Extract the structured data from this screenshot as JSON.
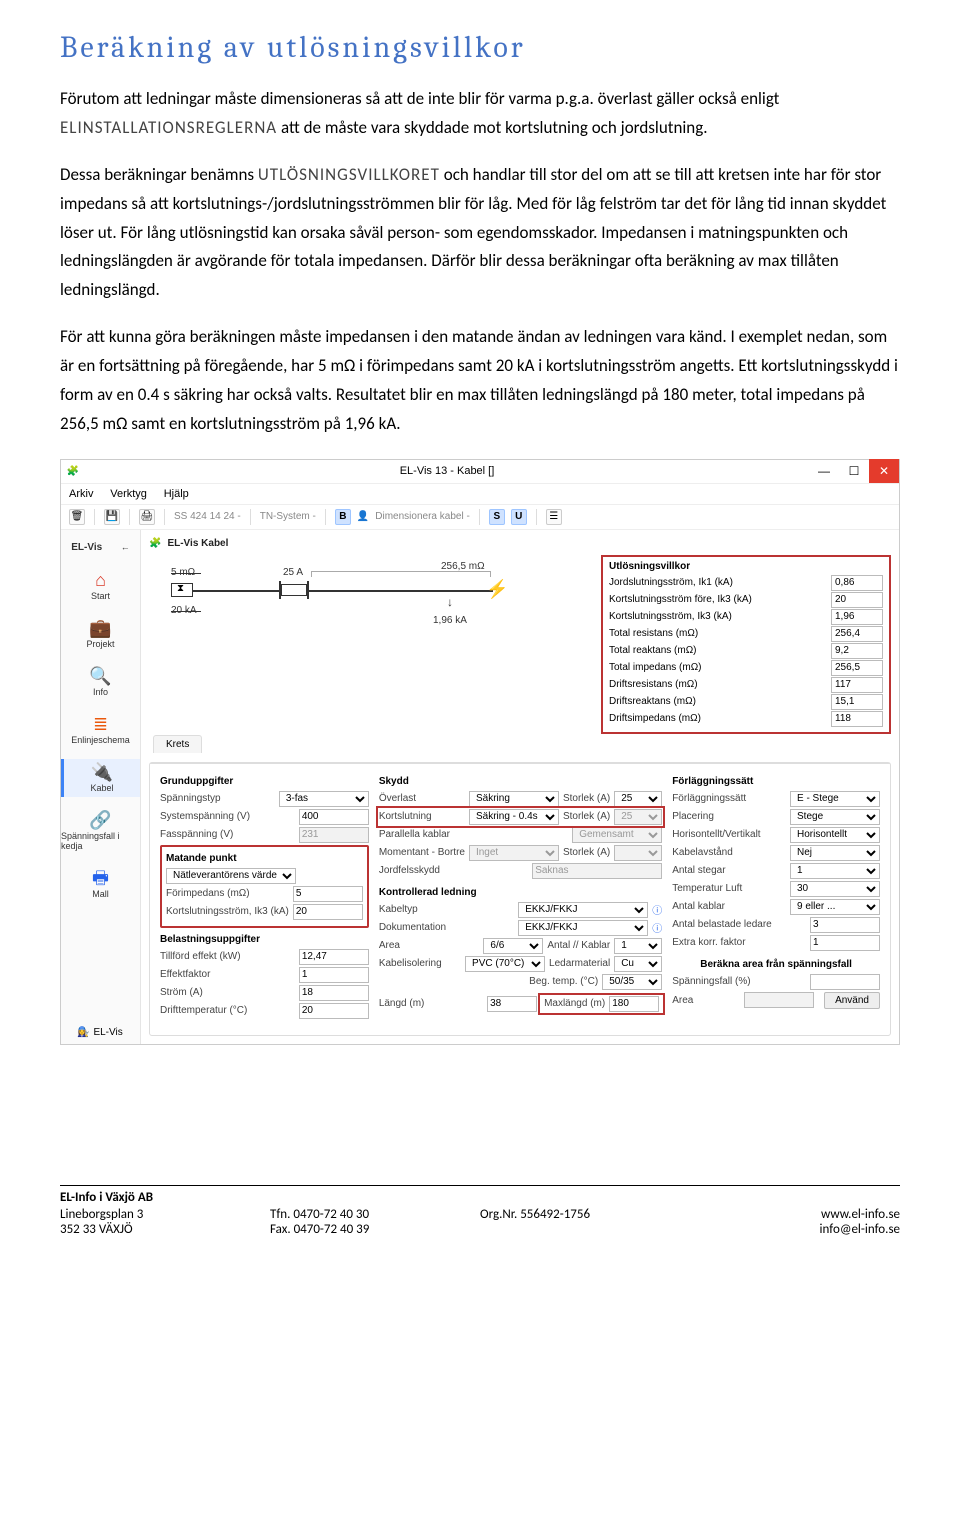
{
  "doc": {
    "heading": "Beräkning av utlösningsvillkor",
    "p1a": "Förutom att ledningar måste dimensioneras så att de inte blir för varma p.g.a. överlast gäller också enligt ",
    "p1r": "ELINSTALLATIONSREGLERNA",
    "p1b": " att de måste vara skyddade mot kortslutning och jordslutning.",
    "p2a": "Dessa beräkningar benämns ",
    "p2r": "UTLÖSNINGSVILLKORET",
    "p2b": " och handlar till stor del om att se till att kretsen inte har för stor impedans så att kortslutnings-/jordslutningsströmmen blir för låg. Med för låg felström tar det för lång tid innan skyddet löser ut. För lång utlösningstid kan orsaka såväl person- som egendomsskador. Impedansen i matningspunkten och ledningslängden är avgörande för totala impedansen. Därför blir dessa beräkningar ofta beräkning av max tillåten ledningslängd.",
    "p3": "För att kunna göra beräkningen måste impedansen i den matande ändan av ledningen vara känd. I exemplet nedan, som är en fortsättning på föregående, har 5 mΩ i förimpedans samt 20 kA i kortslutningsström angetts. Ett kortslutningsskydd i form av en 0.4 s säkring har också valts. Resultatet blir en max tillåten ledningslängd på 180 meter, total impedans på 256,5 mΩ samt en kortslutningsström på 1,96 kA."
  },
  "win": {
    "title": "EL-Vis 13 - Kabel []",
    "menu": {
      "arkiv": "Arkiv",
      "verktyg": "Verktyg",
      "hjalp": "Hjälp"
    },
    "toolbar": {
      "ss": "SS 424 14 24 -",
      "tns": "TN-System -",
      "dim": "Dimensionera kabel -",
      "B": "B",
      "S": "S",
      "U": "U"
    },
    "sidebar_brand": "EL-Vis",
    "subhead": "EL-Vis Kabel",
    "side": {
      "start": "Start",
      "projekt": "Projekt",
      "info": "Info",
      "enlinje": "Enlinjeschema",
      "kabel": "Kabel",
      "spfall": "Spänningsfall i kedja",
      "mall": "Mall"
    }
  },
  "diagram": {
    "imp": "5 mΩ",
    "ik": "20 kA",
    "amp": "25 A",
    "zline": "256,5 mΩ",
    "ikload": "1,96 kA"
  },
  "utlos": {
    "title": "Utlösningsvillkor",
    "rows": {
      "ik1": "Jordslutningsström, Ik1 (kA)",
      "ik1v": "0,86",
      "ik3f": "Kortslutningsström före, Ik3 (kA)",
      "ik3fv": "20",
      "ik3": "Kortslutningsström, Ik3 (kA)",
      "ik3v": "1,96",
      "rtot": "Total resistans (mΩ)",
      "rtotv": "256,4",
      "xtot": "Total reaktans (mΩ)",
      "xtotv": "9,2",
      "ztot": "Total impedans (mΩ)",
      "ztotv": "256,5",
      "rdrift": "Driftsresistans (mΩ)",
      "rdriftv": "117",
      "xdrift": "Driftsreaktans (mΩ)",
      "xdriftv": "15,1",
      "zdrift": "Driftsimpedans (mΩ)",
      "zdriftv": "118"
    }
  },
  "panel": {
    "tab": "Krets",
    "grund": {
      "hdr": "Grunduppgifter",
      "sptyp": "Spänningstyp",
      "sptypv": "3-fas",
      "syssp": "Systemspänning (V)",
      "sysspv": "400",
      "fassp": "Fasspänning (V)",
      "fasspv": "231"
    },
    "mat": {
      "hdr": "Matande punkt",
      "src": "Nätleverantörens värde",
      "forimp": "Förimpedans (mΩ)",
      "forimpv": "5",
      "ik3": "Kortslutningsström, Ik3 (kA)",
      "ik3v": "20"
    },
    "bel": {
      "hdr": "Belastningsuppgifter",
      "eff": "Tillförd effekt (kW)",
      "effv": "12,47",
      "pf": "Effektfaktor",
      "pfv": "1",
      "strom": "Ström (A)",
      "stromv": "18",
      "dtemp": "Drifttemperatur (°C)",
      "dtempv": "20"
    },
    "skydd": {
      "hdr": "Skydd",
      "over": "Överlast",
      "overv": "Säkring",
      "size": "Storlek (A)",
      "sizev": "25",
      "kort": "Kortslutning",
      "kortv": "Säkring - 0.4s",
      "kortsize": "25",
      "par": "Parallella kablar",
      "parv": "Gemensamt",
      "mom": "Momentant - Bortre",
      "momv": "Inget",
      "jord": "Jordfelsskydd",
      "jordv": "Saknas"
    },
    "led": {
      "hdr": "Kontrollerad ledning",
      "ktyp": "Kabeltyp",
      "ktypv": "EKKJ/FKKJ",
      "dok": "Dokumentation",
      "dokv": "EKKJ/FKKJ",
      "area": "Area",
      "areav": "6/6",
      "antk": "Antal // Kablar",
      "antkv": "1",
      "kiso": "Kabelisolering",
      "kisov": "PVC (70°C)",
      "lmat": "Ledarmaterial",
      "lmatv": "Cu",
      "btemp": "Beg. temp. (°C)",
      "btempv": "50/35",
      "langd": "Längd (m)",
      "langdv": "38",
      "maxl": "Maxlängd (m)",
      "maxlv": "180"
    },
    "forl": {
      "hdr": "Förläggningssätt",
      "fsatt": "Förläggningssätt",
      "fsattv": "E - Stege",
      "plac": "Placering",
      "placv": "Stege",
      "hv": "Horisontellt/Vertikalt",
      "hvv": "Horisontellt",
      "kav": "Kabelavstånd",
      "kavv": "Nej",
      "asteg": "Antal stegar",
      "astegv": "1",
      "tluft": "Temperatur Luft",
      "tluftv": "30",
      "akab": "Antal kablar",
      "akabv": "9 eller ...",
      "abled": "Antal belastade ledare",
      "abledv": "3",
      "ekf": "Extra korr. faktor",
      "ekfv": "1",
      "calc": "Beräkna area från spänningsfall",
      "spf": "Spänningsfall (%)",
      "areal": "Area",
      "btn": "Använd"
    }
  },
  "footer": {
    "company": "EL-Info i Växjö AB",
    "addr1": "Lineborgsplan 3",
    "addr2": "352 33 VÄXJÖ",
    "tfn": "Tfn. 0470-72 40 30",
    "fax": "Fax. 0470-72 40 39",
    "org": "Org.Nr. 556492-1756",
    "www": "www.el-info.se",
    "mail": "info@el-info.se"
  },
  "elvis_strip": "EL-Vis"
}
